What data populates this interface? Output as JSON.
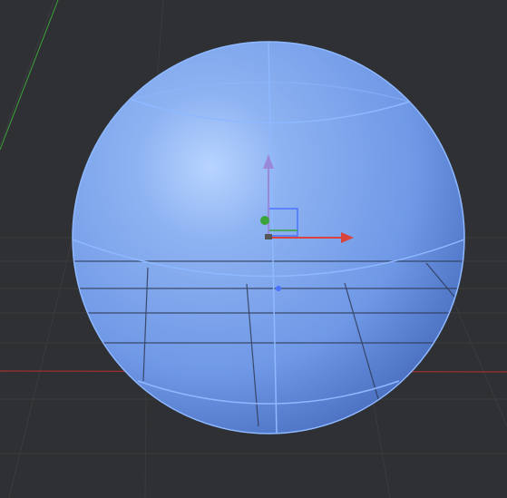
{
  "viewport": {
    "background": "#2f3033",
    "grid_color": "#45474b",
    "grid_minor_color": "#3a3b3e",
    "axis_x_color": "#b8322d",
    "axis_y_color": "#3aa43a"
  },
  "object": {
    "type": "sphere",
    "state": "selected",
    "fill_color": "#6f98e6",
    "highlight_color": "#b8d4ff",
    "shadow_color": "#4a6fc0",
    "outline_color": "#8eb8ff"
  },
  "gizmo": {
    "mode": "translate",
    "x_arrow_color": "#d8443b",
    "y_arrow_color": "#9a88d8",
    "z_handle_color": "#3aa43a",
    "plane_handle_color": "#4a74ff"
  }
}
